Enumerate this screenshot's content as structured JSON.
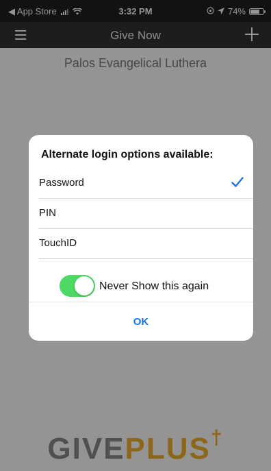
{
  "status_bar": {
    "back_app": "◀ App Store",
    "time": "3:32 PM",
    "battery_text": "74%",
    "battery_level": 0.74
  },
  "nav": {
    "title": "Give Now"
  },
  "org_name": "Palos Evangelical Luthera",
  "dialog": {
    "title": "Alternate login options available:",
    "options": [
      {
        "label": "Password",
        "selected": true
      },
      {
        "label": "PIN",
        "selected": false
      },
      {
        "label": "TouchID",
        "selected": false
      }
    ],
    "toggle_label": "Never Show this again",
    "toggle_on": true,
    "ok_label": "OK"
  },
  "logo": {
    "give": "GIVE",
    "plus": "PLUS"
  },
  "colors": {
    "accent": "#1a73e8",
    "toggle_on": "#4cd964",
    "logo_gold": "#f2b230"
  }
}
